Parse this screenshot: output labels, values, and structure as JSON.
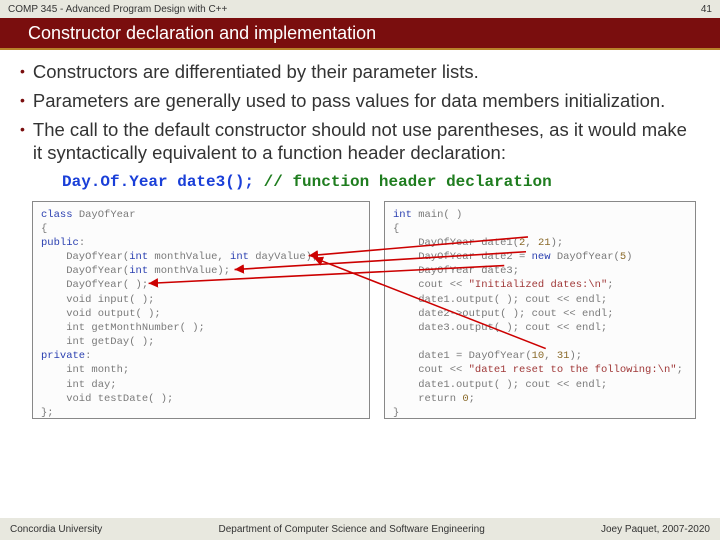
{
  "header": {
    "course": "COMP 345 - Advanced Program Design with C++",
    "page": "41"
  },
  "title": "Constructor declaration and implementation",
  "bullets": [
    "Constructors are differentiated by their parameter lists.",
    "Parameters are generally used to pass values for data members initialization.",
    "The call to the default constructor should not use parentheses, as it would make it syntactically equivalent to a function header declaration:"
  ],
  "code_example": {
    "stmt": "Day.Of.Year date3();",
    "comment": "// function header declaration"
  },
  "left_code": {
    "l1_kw": "class",
    "l1_rest": " DayOfYear",
    "l2": "{",
    "l3_kw": "public",
    "l3_rest": ":",
    "l4a": "    DayOfYear(",
    "l4b": "int",
    "l4c": " monthValue, ",
    "l4d": "int",
    "l4e": " dayValue);",
    "l5a": "    DayOfYear(",
    "l5b": "int",
    "l5c": " monthValue);",
    "l6": "    DayOfYear( );",
    "l7": "    void input( );",
    "l8": "    void output( );",
    "l9": "    int getMonthNumber( );",
    "l10": "    int getDay( );",
    "l11_kw": "private",
    "l11_rest": ":",
    "l12": "    int month;",
    "l13": "    int day;",
    "l14": "    void testDate( );",
    "l15": "};"
  },
  "right_code": {
    "r1a": "int",
    "r1b": " main( )",
    "r2": "{",
    "r3a": "    DayOfYear date1(",
    "r3b": "2",
    "r3c": ", ",
    "r3d": "21",
    "r3e": ");",
    "r4a": "    DayOfYear date2 = ",
    "r4b": "new",
    "r4c": " DayOfYear(",
    "r4d": "5",
    "r4e": ")",
    "r5": "    DayOfYear date3;",
    "r6a": "    cout << ",
    "r6b": "\"Initialized dates:\\n\"",
    "r6c": ";",
    "r7": "    date1.output( ); cout << endl;",
    "r8": "    date2->output( ); cout << endl;",
    "r9": "    date3.output( ); cout << endl;",
    "r10": "",
    "r11a": "    date1 = DayOfYear(",
    "r11b": "10",
    "r11c": ", ",
    "r11d": "31",
    "r11e": ");",
    "r12a": "    cout << ",
    "r12b": "\"date1 reset to the following:\\n\"",
    "r12c": ";",
    "r13": "    date1.output( ); cout << endl;",
    "r14a": "    return ",
    "r14b": "0",
    "r14c": ";",
    "r15": "}"
  },
  "footer": {
    "left": "Concordia University",
    "center": "Department of Computer Science and Software Engineering",
    "right": "Joey Paquet, 2007-2020"
  }
}
